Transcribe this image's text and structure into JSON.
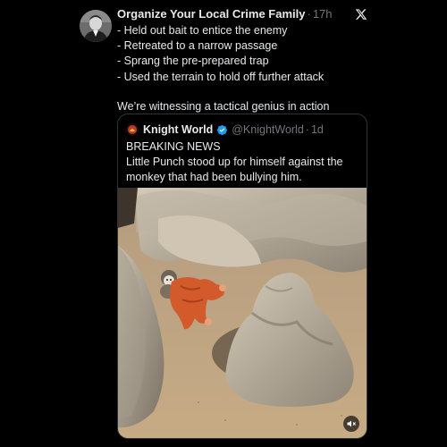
{
  "tweet": {
    "author_name": "Organize Your Local Crime Family",
    "separator": "·",
    "time": "17h",
    "lines": [
      "- Held out bait to entice the enemy",
      "- Retreated to a narrow passage",
      "- Sprang the pre-prepared trap",
      "- Used the terrain to hold off further attack"
    ],
    "closing_line": "We’re witnessing a tactical genius in action"
  },
  "quoted": {
    "author_name": "Knight World",
    "handle": "@KnightWorld",
    "separator": "·",
    "time": "1d",
    "headline": "BREAKING NEWS",
    "text": "Little Punch stood up for himself against the monkey that had been bullying him."
  },
  "icons": {
    "platform": "x-logo-icon",
    "verified": "verified-badge-icon",
    "mute": "speaker-muted-icon"
  },
  "colors": {
    "background": "#000000",
    "text": "#e7e9ea",
    "muted": "#71767b",
    "verified": "#1d9bf0",
    "card_border": "#2f3336"
  }
}
